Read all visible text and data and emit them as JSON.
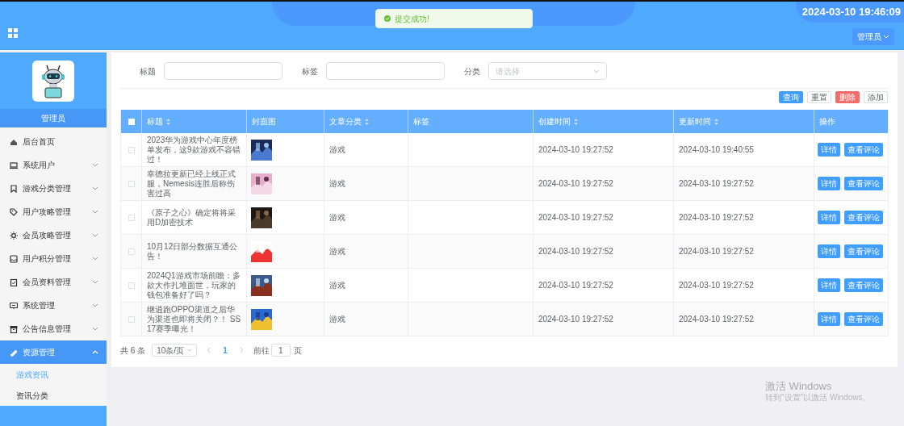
{
  "header": {
    "time": "2024-03-10 19:46:09",
    "user_menu": "管理员"
  },
  "toast": {
    "message": "提交成功!"
  },
  "sidebar": {
    "role": "管理员",
    "items": [
      {
        "label": "后台首页",
        "kind": "link",
        "selected": false
      },
      {
        "label": "系统用户",
        "kind": "menu",
        "expanded": false,
        "selected": false
      },
      {
        "label": "游戏分类管理",
        "kind": "menu",
        "expanded": false,
        "selected": false
      },
      {
        "label": "用户攻略管理",
        "kind": "menu",
        "expanded": false,
        "selected": false
      },
      {
        "label": "会员攻略管理",
        "kind": "menu",
        "expanded": false,
        "selected": false
      },
      {
        "label": "用户积分管理",
        "kind": "menu",
        "expanded": false,
        "selected": false
      },
      {
        "label": "会员资料管理",
        "kind": "menu",
        "expanded": false,
        "selected": false
      },
      {
        "label": "系统管理",
        "kind": "menu",
        "expanded": false,
        "selected": false
      },
      {
        "label": "公告信息管理",
        "kind": "menu",
        "expanded": false,
        "selected": false
      },
      {
        "label": "资源管理",
        "kind": "menu",
        "expanded": true,
        "selected": true,
        "children": [
          {
            "label": "游戏资讯",
            "selected": true
          },
          {
            "label": "资讯分类",
            "selected": false
          }
        ]
      }
    ]
  },
  "filters": [
    {
      "label": "标题",
      "kind": "text"
    },
    {
      "label": "标签",
      "kind": "text"
    },
    {
      "label": "分类",
      "kind": "select",
      "placeholder": "请选择"
    }
  ],
  "actions": [
    {
      "label": "查询",
      "kind": "primary"
    },
    {
      "label": "重置",
      "kind": "default"
    },
    {
      "label": "删除",
      "kind": "danger"
    },
    {
      "label": "添加",
      "kind": "default"
    }
  ],
  "table": {
    "all_checked": false,
    "columns": [
      {
        "label": "标题",
        "sortable": true
      },
      {
        "label": "封面图",
        "sortable": false
      },
      {
        "label": "文章分类",
        "sortable": true
      },
      {
        "label": "标签",
        "sortable": false
      },
      {
        "label": "创建时间",
        "sortable": true
      },
      {
        "label": "更新时间",
        "sortable": true
      },
      {
        "label": "操作",
        "sortable": false
      }
    ],
    "rows": [
      {
        "checked": false,
        "title": "2023华为游戏中心年度榜单发布，这9款游戏不容错过！",
        "category": "游戏",
        "created": "2024-03-10 19:27:52",
        "updated": "2024-03-10 19:40:55",
        "actions": [
          "详情",
          "查看评论"
        ]
      },
      {
        "checked": false,
        "title": "幸德拉更新已经上线正式服，Nemesis连胜后称伤害过高",
        "category": "游戏",
        "created": "2024-03-10 19:27:52",
        "updated": "2024-03-10 19:27:52",
        "actions": [
          "详情",
          "查看评论"
        ]
      },
      {
        "checked": false,
        "title": "《原子之心》确定将将采用D加密技术",
        "category": "游戏",
        "created": "2024-03-10 19:27:52",
        "updated": "2024-03-10 19:27:52",
        "actions": [
          "详情",
          "查看评论"
        ]
      },
      {
        "checked": false,
        "title": "10月12日部分数据互通公告！",
        "category": "游戏",
        "created": "2024-03-10 19:27:52",
        "updated": "2024-03-10 19:27:52",
        "actions": [
          "详情",
          "查看评论"
        ]
      },
      {
        "checked": false,
        "title": "2024Q1游戏市场前瞻：多款大作扎堆面世，玩家的钱包准备好了吗？",
        "category": "游戏",
        "created": "2024-03-10 19:27:52",
        "updated": "2024-03-10 19:27:52",
        "actions": [
          "详情",
          "查看评论"
        ]
      },
      {
        "checked": false,
        "title": "继逍跑OPPO渠道之后华为渠道也即将关闭？！ SS17赛季曝光！",
        "category": "游戏",
        "created": "2024-03-10 19:27:52",
        "updated": "2024-03-10 19:27:52",
        "actions": [
          "详情",
          "查看评论"
        ]
      }
    ]
  },
  "pagination": {
    "total": "共 6 条",
    "page_size": "10条/页",
    "pages": [
      {
        "label": "1",
        "selected": true
      }
    ],
    "goto_label": "前往",
    "goto_value": "1",
    "goto_suffix": "页"
  },
  "activation_notice": {
    "title": "激活 Windows",
    "subtitle": "转到\"设置\"以激活 Windows。"
  }
}
